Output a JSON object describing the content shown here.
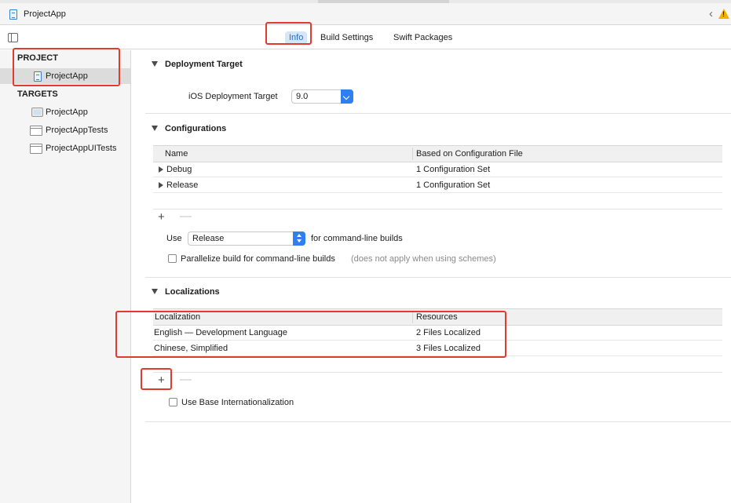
{
  "window": {
    "title": "ProjectApp"
  },
  "tabs": [
    {
      "label": "Info",
      "active": true
    },
    {
      "label": "Build Settings",
      "active": false
    },
    {
      "label": "Swift Packages",
      "active": false
    }
  ],
  "sidebar": {
    "project_header": "PROJECT",
    "project_item": "ProjectApp",
    "targets_header": "TARGETS",
    "targets": [
      "ProjectApp",
      "ProjectAppTests",
      "ProjectAppUITests"
    ]
  },
  "deployment": {
    "header": "Deployment Target",
    "label": "iOS Deployment Target",
    "value": "9.0"
  },
  "configurations": {
    "header": "Configurations",
    "columns": [
      "Name",
      "Based on Configuration File"
    ],
    "rows": [
      {
        "name": "Debug",
        "file": "1 Configuration Set"
      },
      {
        "name": "Release",
        "file": "1 Configuration Set"
      }
    ],
    "use_label": "Use",
    "use_value": "Release",
    "use_suffix": "for command-line builds",
    "parallelize_label": "Parallelize build for command-line builds",
    "parallelize_note": "(does not apply when using schemes)",
    "parallelize_checked": false
  },
  "localizations": {
    "header": "Localizations",
    "columns": [
      "Localization",
      "Resources"
    ],
    "rows": [
      {
        "name": "English — Development Language",
        "resources": "2 Files Localized"
      },
      {
        "name": "Chinese, Simplified",
        "resources": "3 Files Localized"
      }
    ],
    "base_internationalization_label": "Use Base Internationalization",
    "base_internationalization_checked": false
  },
  "buttons": {
    "add": "+",
    "remove": "—"
  },
  "icons": {
    "warning": "!",
    "back": "‹"
  },
  "colors": {
    "accent": "#2f7ff0",
    "tab_active_bg": "#d6e6f9",
    "tab_active_text": "#1f6fd6",
    "annotation_red": "#e23a2e",
    "warning": "#f2b203"
  }
}
